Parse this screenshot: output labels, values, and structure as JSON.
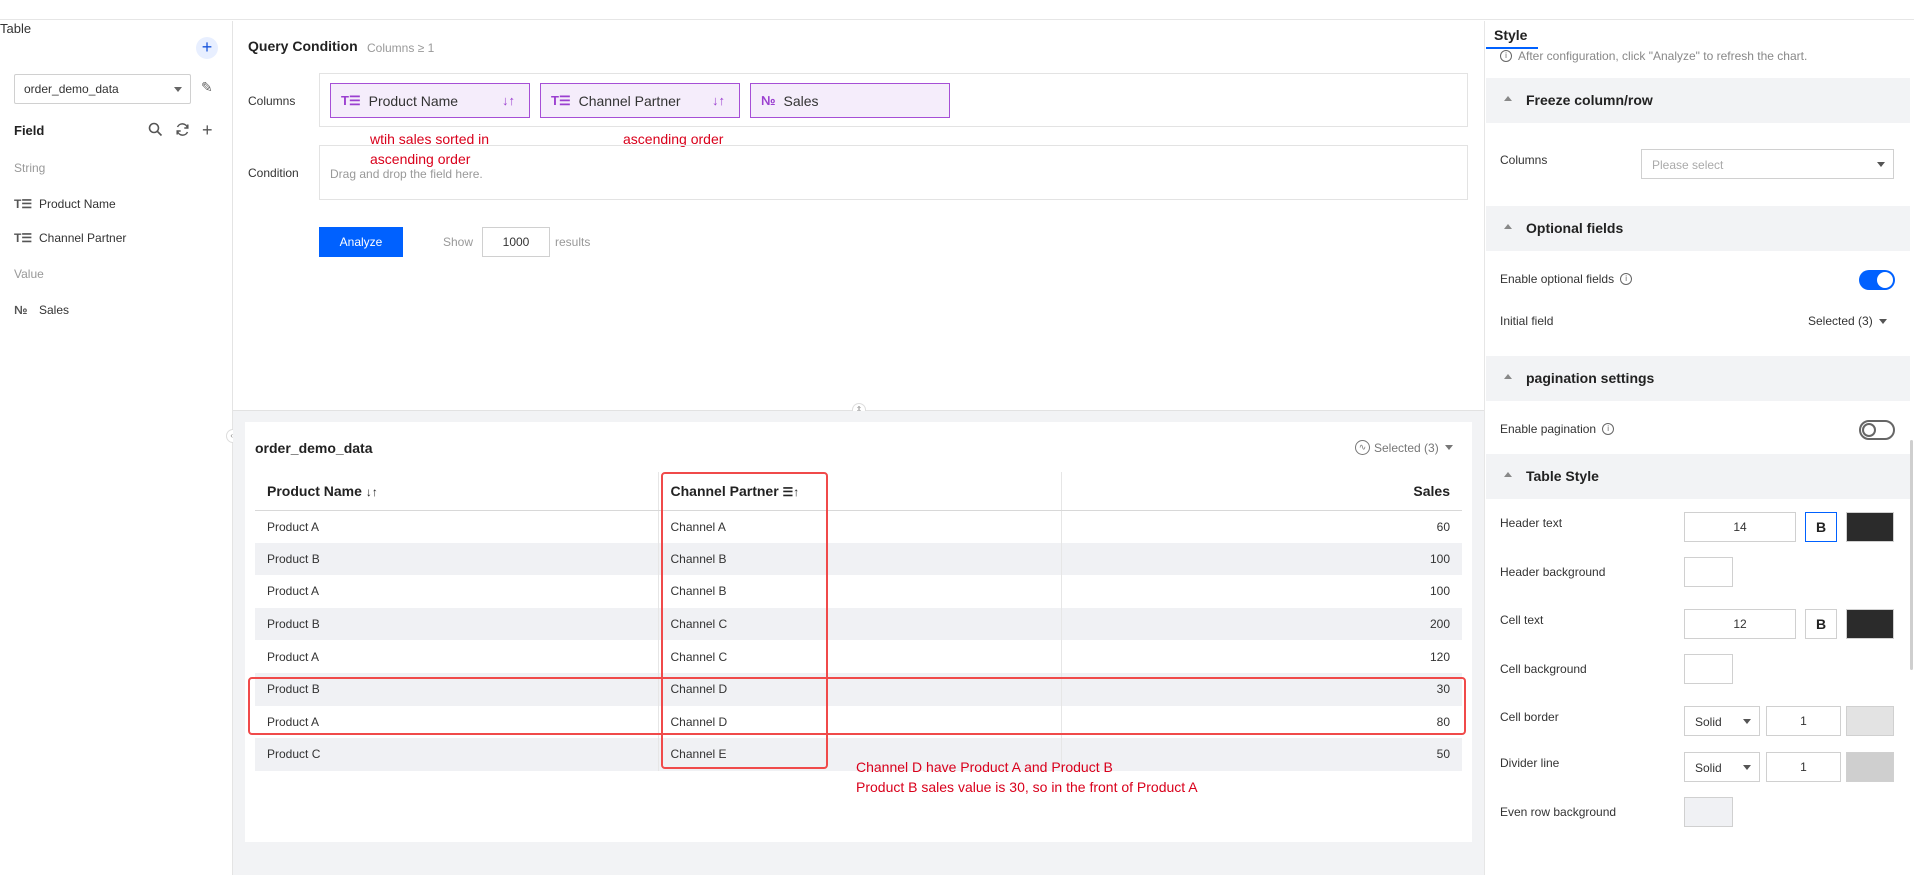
{
  "left": {
    "table_header": "Table",
    "datasource": "order_demo_data",
    "field_header": "Field",
    "groups": {
      "string": "String",
      "value": "Value"
    },
    "fields": {
      "product_name": "Product Name",
      "channel_partner": "Channel Partner",
      "sales": "Sales"
    }
  },
  "query": {
    "title": "Query Condition",
    "subtitle": "Columns ≥ 1",
    "columns_label": "Columns",
    "condition_label": "Condition",
    "chips": [
      "Product Name",
      "Channel Partner",
      "Sales"
    ],
    "condition_placeholder": "Drag and drop the field here.",
    "analyze_label": "Analyze",
    "show_label": "Show",
    "show_value": "1000",
    "results_label": "results"
  },
  "annotations": {
    "a1_line1": "wtih sales sorted in",
    "a1_line2": "ascending order",
    "a2": "ascending order",
    "a3_line1": "Channel D have  Product A  and Product B",
    "a3_line2": "Product B sales value is 30, so in the front of Product A"
  },
  "result": {
    "title": "order_demo_data",
    "selected": "Selected (3)",
    "headers": [
      "Product Name",
      "Channel Partner",
      "Sales"
    ],
    "rows": [
      [
        "Product A",
        "Channel A",
        "60"
      ],
      [
        "Product B",
        "Channel B",
        "100"
      ],
      [
        "Product A",
        "Channel B",
        "100"
      ],
      [
        "Product B",
        "Channel C",
        "200"
      ],
      [
        "Product A",
        "Channel C",
        "120"
      ],
      [
        "Product B",
        "Channel D",
        "30"
      ],
      [
        "Product A",
        "Channel D",
        "80"
      ],
      [
        "Product C",
        "Channel E",
        "50"
      ]
    ]
  },
  "style": {
    "tab": "Style",
    "note": "After configuration, click \"Analyze\" to refresh the chart.",
    "freeze_section": "Freeze column/row",
    "columns_label": "Columns",
    "columns_placeholder": "Please select",
    "optional_section": "Optional fields",
    "enable_optional": "Enable optional fields",
    "enable_optional_on": true,
    "initial_field": "Initial field",
    "initial_field_value": "Selected (3)",
    "pagination_section": "pagination settings",
    "enable_pagination": "Enable pagination",
    "enable_pagination_on": false,
    "table_style_section": "Table Style",
    "header_text": "Header text",
    "header_text_size": "14",
    "bold_label": "B",
    "header_background": "Header background",
    "cell_text": "Cell text",
    "cell_text_size": "12",
    "cell_background": "Cell background",
    "cell_border": "Cell border",
    "cell_border_style": "Solid",
    "cell_border_width": "1",
    "divider_line": "Divider line",
    "divider_style": "Solid",
    "divider_width": "1",
    "even_row_background": "Even row background"
  },
  "colors": {
    "accent": "#0061ff",
    "chip_border": "#a64fd6",
    "annotation": "#d9001b",
    "header_text_color": "#2b2b2b",
    "cell_text_color": "#2b2b2b",
    "cell_border_color": "#e3e3e3",
    "divider_color": "#cfcfcf",
    "even_row_color": "#f0f1f4"
  }
}
